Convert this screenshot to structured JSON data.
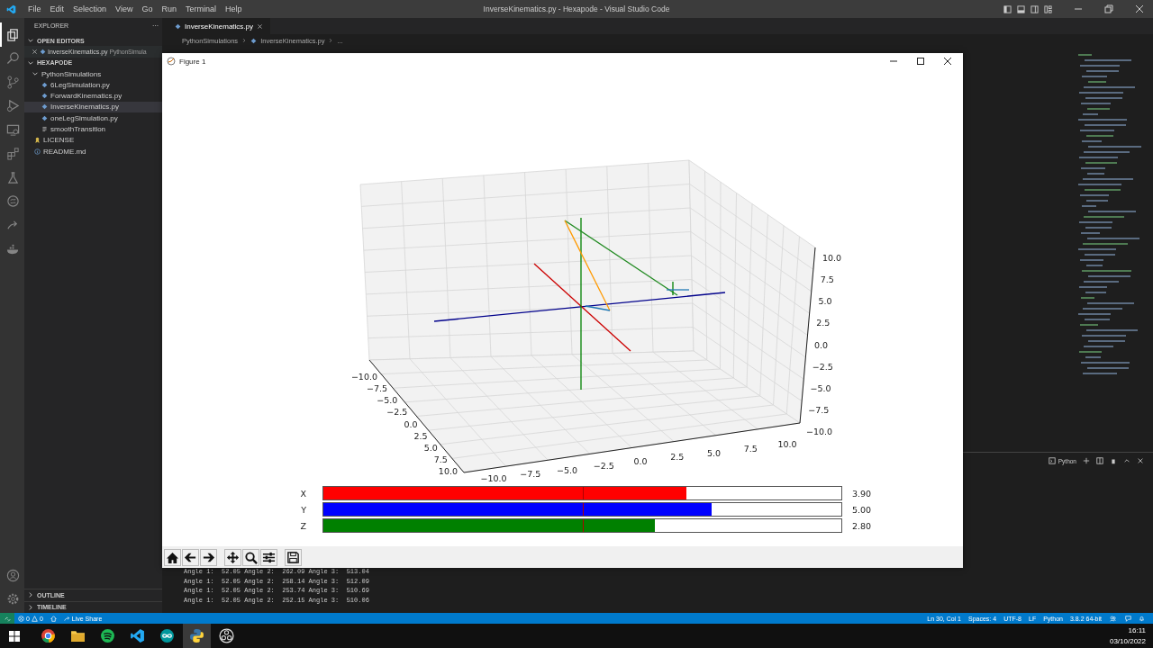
{
  "window": {
    "title": "InverseKinematics.py - Hexapode - Visual Studio Code"
  },
  "menu": [
    "File",
    "Edit",
    "Selection",
    "View",
    "Go",
    "Run",
    "Terminal",
    "Help"
  ],
  "activity_bar": [
    {
      "kind": "files",
      "selected": true
    },
    {
      "kind": "search",
      "selected": false
    },
    {
      "kind": "branch",
      "selected": false
    },
    {
      "kind": "run",
      "selected": false
    },
    {
      "kind": "monitor",
      "selected": false
    },
    {
      "kind": "extensions",
      "selected": false
    },
    {
      "kind": "flask",
      "selected": false
    },
    {
      "kind": "globe",
      "selected": false
    },
    {
      "kind": "share",
      "selected": false
    },
    {
      "kind": "whale",
      "selected": false
    }
  ],
  "sidebar": {
    "title": "EXPLORER",
    "more": "···",
    "open_editors": {
      "label": "OPEN EDITORS",
      "expanded": true,
      "items": [
        {
          "name": "InverseKinematics.py",
          "description": "PythonSimula"
        }
      ]
    },
    "folder": {
      "label": "HEXAPODE",
      "expanded": true,
      "children": [
        {
          "label": "PythonSimulations",
          "kind": "folder",
          "expanded": true,
          "selected": false,
          "children": [
            {
              "label": "6LegSimulation.py",
              "kind": "python",
              "selected": false
            },
            {
              "label": "ForwardKinematics.py",
              "kind": "python",
              "selected": false
            },
            {
              "label": "InverseKinematics.py",
              "kind": "python",
              "selected": true
            },
            {
              "label": "oneLegSimulation.py",
              "kind": "python",
              "selected": false
            },
            {
              "label": "smoothTransition",
              "kind": "text",
              "selected": false
            }
          ]
        },
        {
          "label": "LICENSE",
          "kind": "license",
          "selected": false
        },
        {
          "label": "README.md",
          "kind": "info",
          "selected": false
        }
      ]
    },
    "sections": [
      {
        "label": "OUTLINE",
        "expanded": false
      },
      {
        "label": "TIMELINE",
        "expanded": false
      }
    ]
  },
  "editor": {
    "tabs": [
      {
        "label": "InverseKinematics.py",
        "selected": true
      }
    ],
    "breadcrumbs": [
      "PythonSimulations",
      "InverseKinematics.py",
      "..."
    ]
  },
  "panel": {
    "shell": "Python",
    "lines": [
      "Angle 1:  52.05 Angle 2:  262.09 Angle 3:  513.04",
      "Angle 1:  52.05 Angle 2:  258.14 Angle 3:  512.09",
      "Angle 1:  52.05 Angle 2:  253.74 Angle 3:  510.69",
      "Angle 1:  52.05 Angle 2:  252.15 Angle 3:  510.06"
    ]
  },
  "figure": {
    "title": "Figure 1",
    "plot": {
      "x_tick_labels": [
        "−10.0",
        "−7.5",
        "−5.0",
        "−2.5",
        "0.0",
        "2.5",
        "5.0",
        "7.5",
        "10.0"
      ],
      "y_tick_labels": [
        "−10.0",
        "−7.5",
        "−5.0",
        "−2.5",
        "0.0",
        "2.5",
        "5.0",
        "7.5",
        "10.0"
      ],
      "z_tick_labels": [
        "10.0",
        "7.5",
        "5.0",
        "2.5",
        "0.0",
        "−2.5",
        "−5.0",
        "−7.5",
        "−10.0"
      ]
    },
    "sliders": [
      {
        "label": "X",
        "level": 0.7,
        "reading": "3.90",
        "color": "#ff0000"
      },
      {
        "label": "Y",
        "level": 0.75,
        "reading": "5.00",
        "color": "#0000ff"
      },
      {
        "label": "Z",
        "level": 0.64,
        "reading": "2.80",
        "color": "#008000"
      }
    ],
    "toolbar": [
      {
        "kind": "home"
      },
      {
        "kind": "back"
      },
      {
        "kind": "forward"
      },
      {
        "kind": "pan"
      },
      {
        "kind": "zoom"
      },
      {
        "kind": "configure"
      },
      {
        "kind": "save"
      }
    ]
  },
  "status_bar": {
    "errors": "0",
    "warnings": "0",
    "live_share": "Live Share",
    "right": [
      "Ln 30, Col 1",
      "Spaces: 4",
      "UTF-8",
      "LF",
      "Python",
      "3.8.2 64-bit"
    ]
  },
  "taskbar": {
    "apps": [
      {
        "kind": "chrome",
        "selected": false
      },
      {
        "kind": "folder",
        "selected": false
      },
      {
        "kind": "music",
        "selected": false
      },
      {
        "kind": "code",
        "selected": false
      },
      {
        "kind": "infinity",
        "selected": false
      },
      {
        "kind": "python",
        "selected": true
      },
      {
        "kind": "obs",
        "selected": false
      }
    ],
    "time": "16:11",
    "date": "03/10/2022"
  }
}
